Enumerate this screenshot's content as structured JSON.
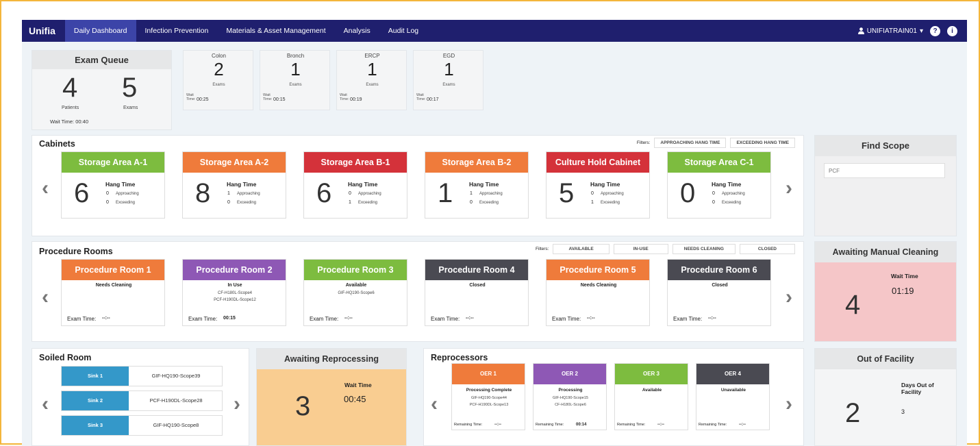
{
  "nav": {
    "brand": "Unifia",
    "items": [
      "Daily Dashboard",
      "Infection Prevention",
      "Materials & Asset Management",
      "Analysis",
      "Audit Log"
    ],
    "user": "UNIFIATRAIN01",
    "user_caret": "▾",
    "help": "?",
    "info": "i"
  },
  "exam_queue": {
    "title": "Exam Queue",
    "patients": "4",
    "patients_label": "Patients",
    "exams": "5",
    "exams_label": "Exams",
    "wait": "Wait Time: 00:40"
  },
  "procedures": [
    {
      "name": "Colon",
      "count": "2",
      "label": "Exams",
      "wait_label": "Wait Time:",
      "wait": "00:25"
    },
    {
      "name": "Bronch",
      "count": "1",
      "label": "Exams",
      "wait_label": "Wait Time:",
      "wait": "00:15"
    },
    {
      "name": "ERCP",
      "count": "1",
      "label": "Exams",
      "wait_label": "Wait Time:",
      "wait": "00:19"
    },
    {
      "name": "EGD",
      "count": "1",
      "label": "Exams",
      "wait_label": "Wait Time:",
      "wait": "00:17"
    }
  ],
  "cabinets": {
    "title": "Cabinets",
    "filters_label": "Filters:",
    "filters": [
      "APPROACHING HANG TIME",
      "EXCEEDING HANG TIME"
    ],
    "items": [
      {
        "name": "Storage Area A-1",
        "color": "green",
        "count": "6",
        "hang": "Hang Time",
        "approaching": "0",
        "exceeding": "0"
      },
      {
        "name": "Storage Area A-2",
        "color": "orange",
        "count": "8",
        "hang": "Hang Time",
        "approaching": "1",
        "exceeding": "0"
      },
      {
        "name": "Storage Area B-1",
        "color": "red",
        "count": "6",
        "hang": "Hang Time",
        "approaching": "0",
        "exceeding": "1"
      },
      {
        "name": "Storage Area B-2",
        "color": "orange",
        "count": "1",
        "hang": "Hang Time",
        "approaching": "1",
        "exceeding": "0"
      },
      {
        "name": "Culture Hold Cabinet",
        "color": "red",
        "count": "5",
        "hang": "Hang Time",
        "approaching": "0",
        "exceeding": "1"
      },
      {
        "name": "Storage Area C-1",
        "color": "green",
        "count": "0",
        "hang": "Hang Time",
        "approaching": "0",
        "exceeding": "0"
      }
    ],
    "approaching_label": "Approaching",
    "exceeding_label": "Exceeding"
  },
  "find_scope": {
    "title": "Find Scope",
    "placeholder": "PCF"
  },
  "rooms": {
    "title": "Procedure Rooms",
    "filters_label": "Filters:",
    "filters": [
      "AVAILABLE",
      "IN-USE",
      "NEEDS CLEANING",
      "CLOSED"
    ],
    "exam_label": "Exam Time:",
    "items": [
      {
        "name": "Procedure Room 1",
        "color": "orange",
        "status": "Needs Cleaning",
        "scopes": [
          "",
          ""
        ],
        "exam": "--:--"
      },
      {
        "name": "Procedure Room 2",
        "color": "purple",
        "status": "In Use",
        "scopes": [
          "CF-H180L-Scope4",
          "PCF-H190DL-Scope12"
        ],
        "exam": "00:15"
      },
      {
        "name": "Procedure Room 3",
        "color": "green",
        "status": "Available",
        "scopes": [
          "GIF-HQ190-Scope6",
          ""
        ],
        "exam": "--:--"
      },
      {
        "name": "Procedure Room 4",
        "color": "dgray",
        "status": "Closed",
        "scopes": [
          "",
          ""
        ],
        "exam": "--:--"
      },
      {
        "name": "Procedure Room 5",
        "color": "orange",
        "status": "Needs Cleaning",
        "scopes": [
          "",
          ""
        ],
        "exam": "--:--"
      },
      {
        "name": "Procedure Room 6",
        "color": "dgray",
        "status": "Closed",
        "scopes": [
          "",
          ""
        ],
        "exam": "--:--"
      }
    ]
  },
  "manual_cleaning": {
    "title": "Awaiting Manual Cleaning",
    "count": "4",
    "wait_label": "Wait Time",
    "wait": "01:19"
  },
  "soiled": {
    "title": "Soiled Room",
    "sinks": [
      {
        "name": "Sink 1",
        "scope": "GIF-HQ190-Scope39"
      },
      {
        "name": "Sink 2",
        "scope": "PCF-H190DL-Scope28"
      },
      {
        "name": "Sink 3",
        "scope": "GIF-HQ190-Scope8"
      }
    ]
  },
  "reprocessing": {
    "title": "Awaiting Reprocessing",
    "count": "3",
    "wait_label": "Wait Time",
    "wait": "00:45"
  },
  "reprocessors": {
    "title": "Reprocessors",
    "remaining_label": "Remaining Time:",
    "items": [
      {
        "name": "OER 1",
        "color": "orange",
        "status": "Processing Complete",
        "scopes": [
          "GIF-HQ190-Scope44",
          "PCF-H190DL-Scope13"
        ],
        "remaining": "--:--"
      },
      {
        "name": "OER 2",
        "color": "purple",
        "status": "Processing",
        "scopes": [
          "GIF-HQ190-Scope15",
          "CF-H180L-Scope6"
        ],
        "remaining": "00:14"
      },
      {
        "name": "OER 3",
        "color": "green",
        "status": "Available",
        "scopes": [
          "",
          ""
        ],
        "remaining": "--:--"
      },
      {
        "name": "OER 4",
        "color": "dgray",
        "status": "Unavailable",
        "scopes": [
          "",
          ""
        ],
        "remaining": "--:--"
      }
    ]
  },
  "out_of_facility": {
    "title": "Out of Facility",
    "count": "2",
    "days_label": "Days Out of Facility",
    "days": "3"
  },
  "arrows": {
    "left": "‹",
    "right": "›"
  }
}
